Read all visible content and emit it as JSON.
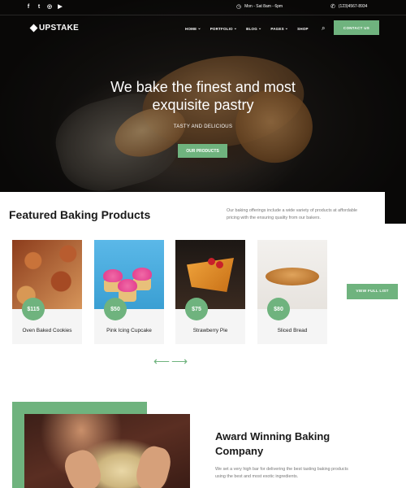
{
  "colors": {
    "accent": "#6fb37e",
    "dark": "#141210"
  },
  "topbar": {
    "social_icons": [
      "facebook-icon",
      "twitter-icon",
      "instagram-icon",
      "youtube-icon"
    ],
    "social_glyphs": [
      "f",
      "t",
      "◎",
      "▶"
    ],
    "hours": "Mon - Sat 8am - 6pm",
    "phone": "(123)4567-8934"
  },
  "header": {
    "logo": "UPSTAKE",
    "nav": [
      {
        "label": "HOME",
        "dropdown": true
      },
      {
        "label": "PORTFOLIO",
        "dropdown": true
      },
      {
        "label": "BLOG",
        "dropdown": true
      },
      {
        "label": "PAGES",
        "dropdown": true
      },
      {
        "label": "SHOP",
        "dropdown": false
      }
    ],
    "chevron": "⌄",
    "contact_label": "CONTACT US"
  },
  "hero": {
    "title_line1": "We bake the finest and most",
    "title_line2": "exquisite pastry",
    "subtitle": "TASTY AND DELICIOUS",
    "button_label": "OUR PRODUCTS"
  },
  "featured": {
    "title": "Featured Baking Products",
    "description": "Our baking offerings include a wide variety of products at affordable pricing with the ensuring quality from our bakers.",
    "products": [
      {
        "name": "Oven Baked Cookies",
        "price": "$115"
      },
      {
        "name": "Pink Icing Cupcake",
        "price": "$50"
      },
      {
        "name": "Strawberry Pie",
        "price": "$75"
      },
      {
        "name": "Sliced Bread",
        "price": "$80"
      }
    ],
    "view_full_label": "VIEW FULL LIST",
    "prev_arrow": "⟵",
    "next_arrow": "⟶"
  },
  "award": {
    "title_line1": "Award Winning Baking",
    "title_line2": "Company",
    "description": "We set a very high bar for delivering the best tasting baking products using the best and most exotic ingredients."
  }
}
